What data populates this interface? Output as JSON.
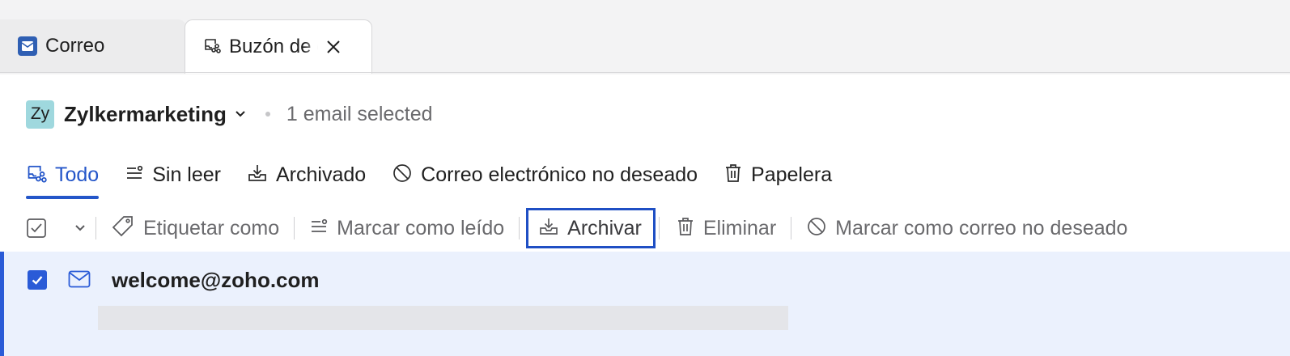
{
  "tabs": [
    {
      "label": "Correo",
      "icon": "mail-icon"
    },
    {
      "label": "Buzón de correo compartido",
      "icon": "shared-mailbox-icon"
    }
  ],
  "account": {
    "avatar_text": "Zy",
    "name": "Zylkermarketing",
    "selection_status": "1 email selected"
  },
  "filters": [
    {
      "label": "Todo",
      "icon": "shared-mailbox-icon",
      "active": true
    },
    {
      "label": "Sin leer",
      "icon": "unread-icon"
    },
    {
      "label": "Archivado",
      "icon": "archive-icon"
    },
    {
      "label": "Correo electrónico no deseado",
      "icon": "block-icon"
    },
    {
      "label": "Papelera",
      "icon": "trash-icon"
    }
  ],
  "toolbar": {
    "tag_label": "Etiquetar como",
    "mark_read_label": "Marcar como leído",
    "archive_label": "Archivar",
    "delete_label": "Eliminar",
    "spam_label": "Marcar como correo no deseado"
  },
  "emails": [
    {
      "sender": "welcome@zoho.com",
      "selected": true
    }
  ],
  "colors": {
    "accent": "#2456c9",
    "selected_row_bg": "#ebf1fd",
    "avatar_bg": "#9fd8de",
    "highlight_border": "#1f4fc4"
  }
}
